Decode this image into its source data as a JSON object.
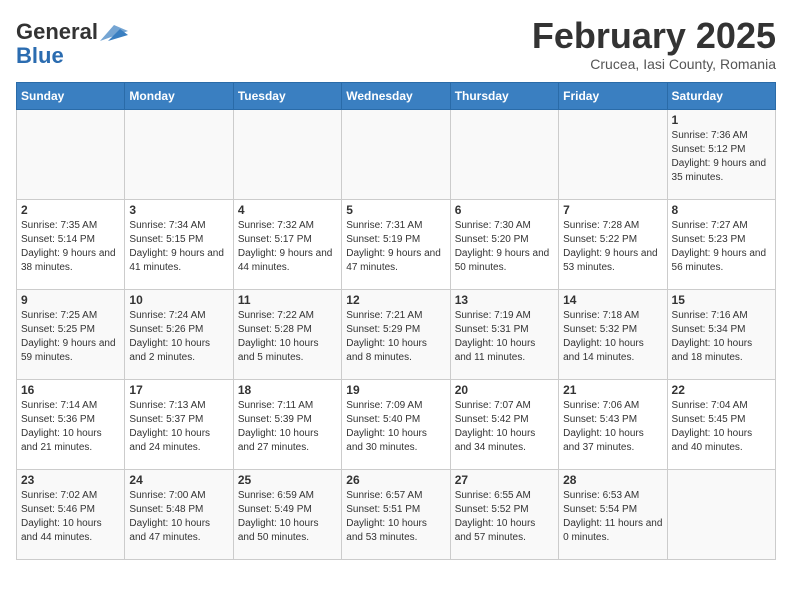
{
  "header": {
    "logo_general": "General",
    "logo_blue": "Blue",
    "month_title": "February 2025",
    "location": "Crucea, Iasi County, Romania"
  },
  "weekdays": [
    "Sunday",
    "Monday",
    "Tuesday",
    "Wednesday",
    "Thursday",
    "Friday",
    "Saturday"
  ],
  "weeks": [
    [
      {
        "day": "",
        "info": ""
      },
      {
        "day": "",
        "info": ""
      },
      {
        "day": "",
        "info": ""
      },
      {
        "day": "",
        "info": ""
      },
      {
        "day": "",
        "info": ""
      },
      {
        "day": "",
        "info": ""
      },
      {
        "day": "1",
        "info": "Sunrise: 7:36 AM\nSunset: 5:12 PM\nDaylight: 9 hours and 35 minutes."
      }
    ],
    [
      {
        "day": "2",
        "info": "Sunrise: 7:35 AM\nSunset: 5:14 PM\nDaylight: 9 hours and 38 minutes."
      },
      {
        "day": "3",
        "info": "Sunrise: 7:34 AM\nSunset: 5:15 PM\nDaylight: 9 hours and 41 minutes."
      },
      {
        "day": "4",
        "info": "Sunrise: 7:32 AM\nSunset: 5:17 PM\nDaylight: 9 hours and 44 minutes."
      },
      {
        "day": "5",
        "info": "Sunrise: 7:31 AM\nSunset: 5:19 PM\nDaylight: 9 hours and 47 minutes."
      },
      {
        "day": "6",
        "info": "Sunrise: 7:30 AM\nSunset: 5:20 PM\nDaylight: 9 hours and 50 minutes."
      },
      {
        "day": "7",
        "info": "Sunrise: 7:28 AM\nSunset: 5:22 PM\nDaylight: 9 hours and 53 minutes."
      },
      {
        "day": "8",
        "info": "Sunrise: 7:27 AM\nSunset: 5:23 PM\nDaylight: 9 hours and 56 minutes."
      }
    ],
    [
      {
        "day": "9",
        "info": "Sunrise: 7:25 AM\nSunset: 5:25 PM\nDaylight: 9 hours and 59 minutes."
      },
      {
        "day": "10",
        "info": "Sunrise: 7:24 AM\nSunset: 5:26 PM\nDaylight: 10 hours and 2 minutes."
      },
      {
        "day": "11",
        "info": "Sunrise: 7:22 AM\nSunset: 5:28 PM\nDaylight: 10 hours and 5 minutes."
      },
      {
        "day": "12",
        "info": "Sunrise: 7:21 AM\nSunset: 5:29 PM\nDaylight: 10 hours and 8 minutes."
      },
      {
        "day": "13",
        "info": "Sunrise: 7:19 AM\nSunset: 5:31 PM\nDaylight: 10 hours and 11 minutes."
      },
      {
        "day": "14",
        "info": "Sunrise: 7:18 AM\nSunset: 5:32 PM\nDaylight: 10 hours and 14 minutes."
      },
      {
        "day": "15",
        "info": "Sunrise: 7:16 AM\nSunset: 5:34 PM\nDaylight: 10 hours and 18 minutes."
      }
    ],
    [
      {
        "day": "16",
        "info": "Sunrise: 7:14 AM\nSunset: 5:36 PM\nDaylight: 10 hours and 21 minutes."
      },
      {
        "day": "17",
        "info": "Sunrise: 7:13 AM\nSunset: 5:37 PM\nDaylight: 10 hours and 24 minutes."
      },
      {
        "day": "18",
        "info": "Sunrise: 7:11 AM\nSunset: 5:39 PM\nDaylight: 10 hours and 27 minutes."
      },
      {
        "day": "19",
        "info": "Sunrise: 7:09 AM\nSunset: 5:40 PM\nDaylight: 10 hours and 30 minutes."
      },
      {
        "day": "20",
        "info": "Sunrise: 7:07 AM\nSunset: 5:42 PM\nDaylight: 10 hours and 34 minutes."
      },
      {
        "day": "21",
        "info": "Sunrise: 7:06 AM\nSunset: 5:43 PM\nDaylight: 10 hours and 37 minutes."
      },
      {
        "day": "22",
        "info": "Sunrise: 7:04 AM\nSunset: 5:45 PM\nDaylight: 10 hours and 40 minutes."
      }
    ],
    [
      {
        "day": "23",
        "info": "Sunrise: 7:02 AM\nSunset: 5:46 PM\nDaylight: 10 hours and 44 minutes."
      },
      {
        "day": "24",
        "info": "Sunrise: 7:00 AM\nSunset: 5:48 PM\nDaylight: 10 hours and 47 minutes."
      },
      {
        "day": "25",
        "info": "Sunrise: 6:59 AM\nSunset: 5:49 PM\nDaylight: 10 hours and 50 minutes."
      },
      {
        "day": "26",
        "info": "Sunrise: 6:57 AM\nSunset: 5:51 PM\nDaylight: 10 hours and 53 minutes."
      },
      {
        "day": "27",
        "info": "Sunrise: 6:55 AM\nSunset: 5:52 PM\nDaylight: 10 hours and 57 minutes."
      },
      {
        "day": "28",
        "info": "Sunrise: 6:53 AM\nSunset: 5:54 PM\nDaylight: 11 hours and 0 minutes."
      },
      {
        "day": "",
        "info": ""
      }
    ]
  ]
}
